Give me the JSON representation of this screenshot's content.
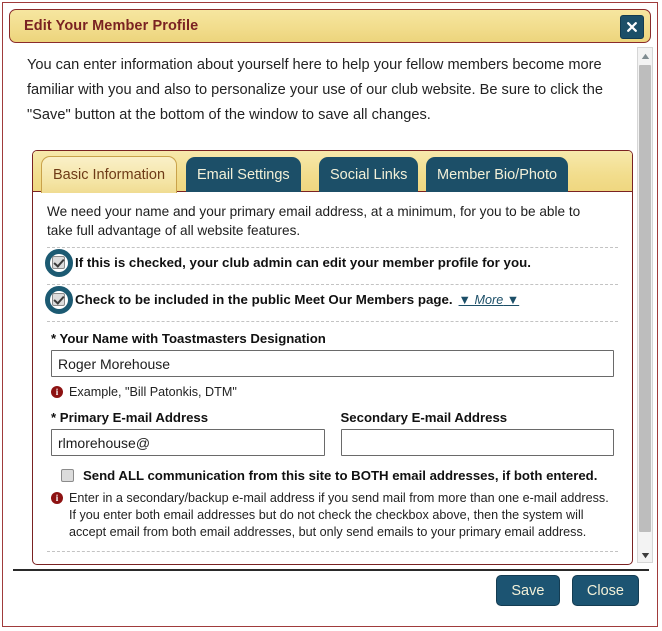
{
  "dialog": {
    "title": "Edit Your Member Profile",
    "close_icon": "close-x-icon",
    "intro": "You can enter information about yourself here to help your fellow members become more familiar with you and also to personalize your use of our club website. Be sure to click the \"Save\" button at the bottom of the window to save all changes."
  },
  "tabs": [
    {
      "label": "Basic Information",
      "active": true
    },
    {
      "label": "Email Settings",
      "active": false
    },
    {
      "label": "Social Links",
      "active": false
    },
    {
      "label": "Member Bio/Photo",
      "active": false
    }
  ],
  "panel": {
    "intro": "We need your name and your primary email address, at a minimum, for you to be able to take full advantage of all website features.",
    "admin_edit": {
      "label": "If this is checked, your club admin can edit your member profile for you.",
      "checked": true,
      "highlighted": true
    },
    "meet_members": {
      "label": "Check to be included in the public Meet Our Members page.",
      "checked": true,
      "highlighted": true,
      "more_link_prefix": "▼ ",
      "more_link_text": "More",
      "more_link_suffix": " ▼"
    },
    "name_field": {
      "label": "* Your Name with Toastmasters Designation",
      "value": "Roger Morehouse",
      "placeholder": "",
      "hint": "Example, \"Bill Patonkis, DTM\""
    },
    "primary_email": {
      "label": "* Primary E-mail Address",
      "value": "rlmorehouse@",
      "placeholder": ""
    },
    "secondary_email": {
      "label": "Secondary E-mail Address",
      "value": "",
      "placeholder": ""
    },
    "both_emails": {
      "label": "Send ALL communication from this site to BOTH email addresses, if both entered.",
      "checked": false
    },
    "email_hint": "Enter in a secondary/backup e-mail address if you send mail from more than one e-mail address. If you enter both email addresses but do not check the checkbox above, then the system will accept email from both email addresses, but only send emails to your primary email address."
  },
  "footer": {
    "save_label": "Save",
    "close_label": "Close"
  },
  "scrollbar": {
    "up_icon": "triangle-up-icon",
    "down_icon": "triangle-down-icon"
  },
  "colors": {
    "title_bar": "#f2dd8d",
    "title_text": "#7a2222",
    "accent_teal": "#1c4f68",
    "dialog_border": "#a03b3b",
    "tab_active_bg": "#f4e4a4",
    "info_icon": "#8d1212"
  }
}
